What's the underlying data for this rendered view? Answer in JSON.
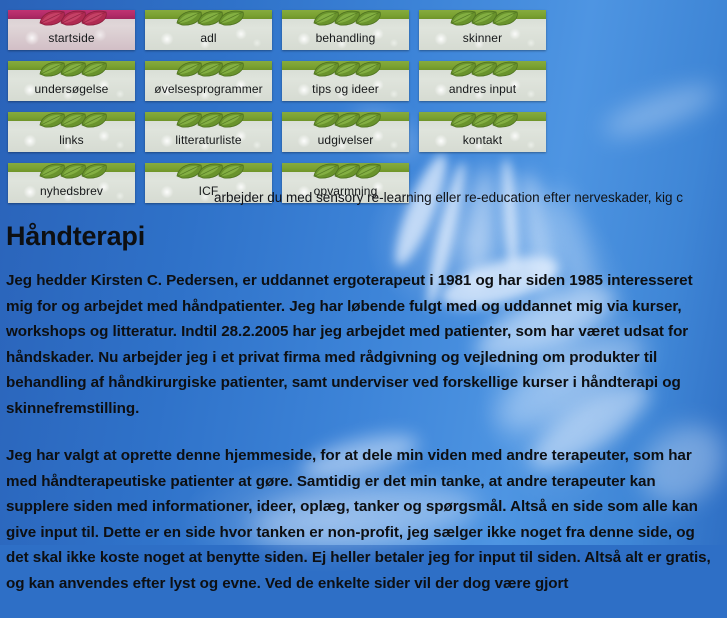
{
  "colors": {
    "sky_blue": "#2f72c9",
    "leaf_green": "#7ba232",
    "leaf_green_dark": "#5d8a2a",
    "active_band_magenta": "#b32b68",
    "active_leaf_red": "#b02a52",
    "button_stone": "#dfe4dc",
    "text_dark": "#0d0f12"
  },
  "nav": {
    "items": [
      {
        "label": "startside",
        "icon": "leaf-trio-icon",
        "active": true
      },
      {
        "label": "adl",
        "icon": "leaf-trio-icon",
        "active": false
      },
      {
        "label": "behandling",
        "icon": "leaf-trio-icon",
        "active": false
      },
      {
        "label": "skinner",
        "icon": "leaf-trio-icon",
        "active": false
      },
      {
        "label": "undersøgelse",
        "icon": "leaf-trio-icon",
        "active": false
      },
      {
        "label": "øvelsesprogrammer",
        "icon": "leaf-trio-icon",
        "active": false
      },
      {
        "label": "tips og ideer",
        "icon": "leaf-trio-icon",
        "active": false
      },
      {
        "label": "andres input",
        "icon": "leaf-trio-icon",
        "active": false
      },
      {
        "label": "links",
        "icon": "leaf-trio-icon",
        "active": false
      },
      {
        "label": "litteraturliste",
        "icon": "leaf-trio-icon",
        "active": false
      },
      {
        "label": "udgivelser",
        "icon": "leaf-trio-icon",
        "active": false
      },
      {
        "label": "kontakt",
        "icon": "leaf-trio-icon",
        "active": false
      },
      {
        "label": "nyhedsbrev",
        "icon": "leaf-trio-icon",
        "active": false
      },
      {
        "label": "ICF",
        "icon": "leaf-trio-icon",
        "active": false
      },
      {
        "label": "opvarmning",
        "icon": "leaf-trio-icon",
        "active": false
      }
    ]
  },
  "marquee": {
    "text": "arbejder du med sensory re-learning eller re-education efter nerveskader, kig c"
  },
  "main": {
    "title": "Håndterapi",
    "paragraphs": [
      "Jeg hedder Kirsten C. Pedersen, er uddannet ergoterapeut i 1981 og har siden 1985 interesseret mig for og arbejdet med håndpatienter. Jeg har løbende fulgt med og uddannet mig via kurser, workshops og litteratur. Indtil 28.2.2005 har jeg arbejdet med patienter, som har været udsat for håndskader. Nu arbejder jeg i et privat firma med rådgivning og vejledning om produkter til behandling af håndkirurgiske patienter, samt underviser ved forskellige kurser i håndterapi og skinnefremstilling.",
      "Jeg har valgt at oprette denne hjemmeside, for at dele min viden med andre terapeuter, som har med håndterapeutiske patienter at gøre. Samtidig er det min tanke, at andre terapeuter kan supplere siden med informationer, ideer, oplæg, tanker og spørgsmål. Altså en side som alle kan give input til. Dette er en side hvor tanken er non-profit, jeg sælger ikke noget fra denne side, og det skal ikke koste noget at benytte siden. Ej heller betaler jeg for input til siden. Altså alt er gratis, og kan anvendes efter lyst og evne. Ved de enkelte sider vil der dog være gjort"
    ]
  }
}
